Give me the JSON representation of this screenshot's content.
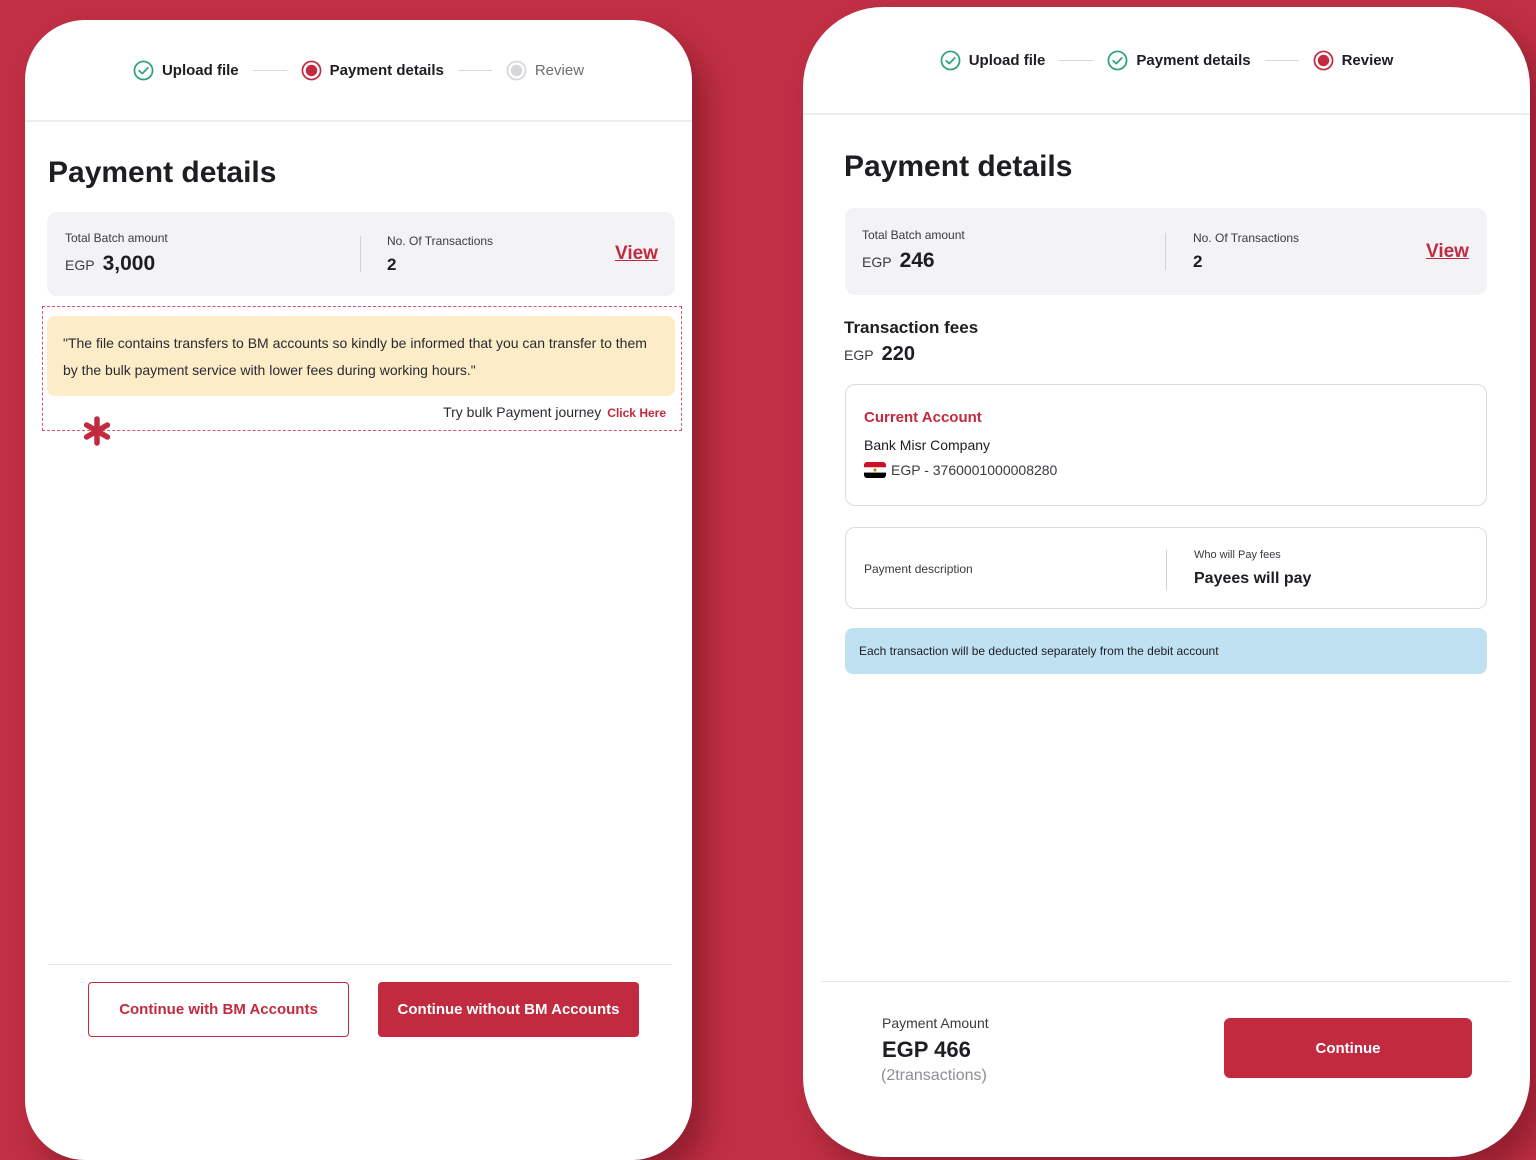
{
  "colors": {
    "background": "#c12f44",
    "accent": "#c22a3f",
    "success": "#2aa17b",
    "notice_bg": "#fdecc8",
    "info_bg": "#bfe1f1",
    "card_bg": "#f3f3f5"
  },
  "left_screen": {
    "stepper": [
      {
        "label": "Upload file",
        "state": "done",
        "icon": "check-circle-icon"
      },
      {
        "label": "Payment details",
        "state": "active",
        "icon": "active-dot-icon"
      },
      {
        "label": "Review",
        "state": "pending",
        "icon": "pending-dot-icon"
      }
    ],
    "title": "Payment details",
    "summary": {
      "batch_label": "Total Batch amount",
      "batch_currency": "EGP",
      "batch_amount": "3,000",
      "tx_label": "No. Of Transactions",
      "tx_count": "2",
      "view_label": "View"
    },
    "notice": {
      "text": "\"The file contains transfers to BM accounts so kindly be informed that you can transfer to them by the bulk payment service with lower fees during working hours.\"",
      "try_label": "Try bulk Payment journey",
      "click_label": "Click Here"
    },
    "buttons": {
      "with_bm": "Continue with BM Accounts",
      "without_bm": "Continue without BM Accounts"
    }
  },
  "right_screen": {
    "stepper": [
      {
        "label": "Upload file",
        "state": "done",
        "icon": "check-circle-icon"
      },
      {
        "label": "Payment details",
        "state": "done",
        "icon": "check-circle-icon"
      },
      {
        "label": "Review",
        "state": "active",
        "icon": "active-dot-icon"
      }
    ],
    "title": "Payment details",
    "summary": {
      "batch_label": "Total Batch amount",
      "batch_currency": "EGP",
      "batch_amount": "246",
      "tx_label": "No. Of Transactions",
      "tx_count": "2",
      "view_label": "View"
    },
    "fees": {
      "title": "Transaction fees",
      "currency": "EGP",
      "amount": "220"
    },
    "account": {
      "type": "Current Account",
      "name": "Bank Misr Company",
      "number": "EGP - 3760001000008280"
    },
    "description": {
      "label": "Payment description",
      "payer_label": "Who will Pay fees",
      "payer_value": "Payees will pay"
    },
    "info_text": "Each transaction will be deducted separately from the debit account",
    "footer": {
      "amount_label": "Payment Amount",
      "amount_value": "EGP 466",
      "note": "(2transactions)",
      "continue_label": "Continue"
    }
  }
}
